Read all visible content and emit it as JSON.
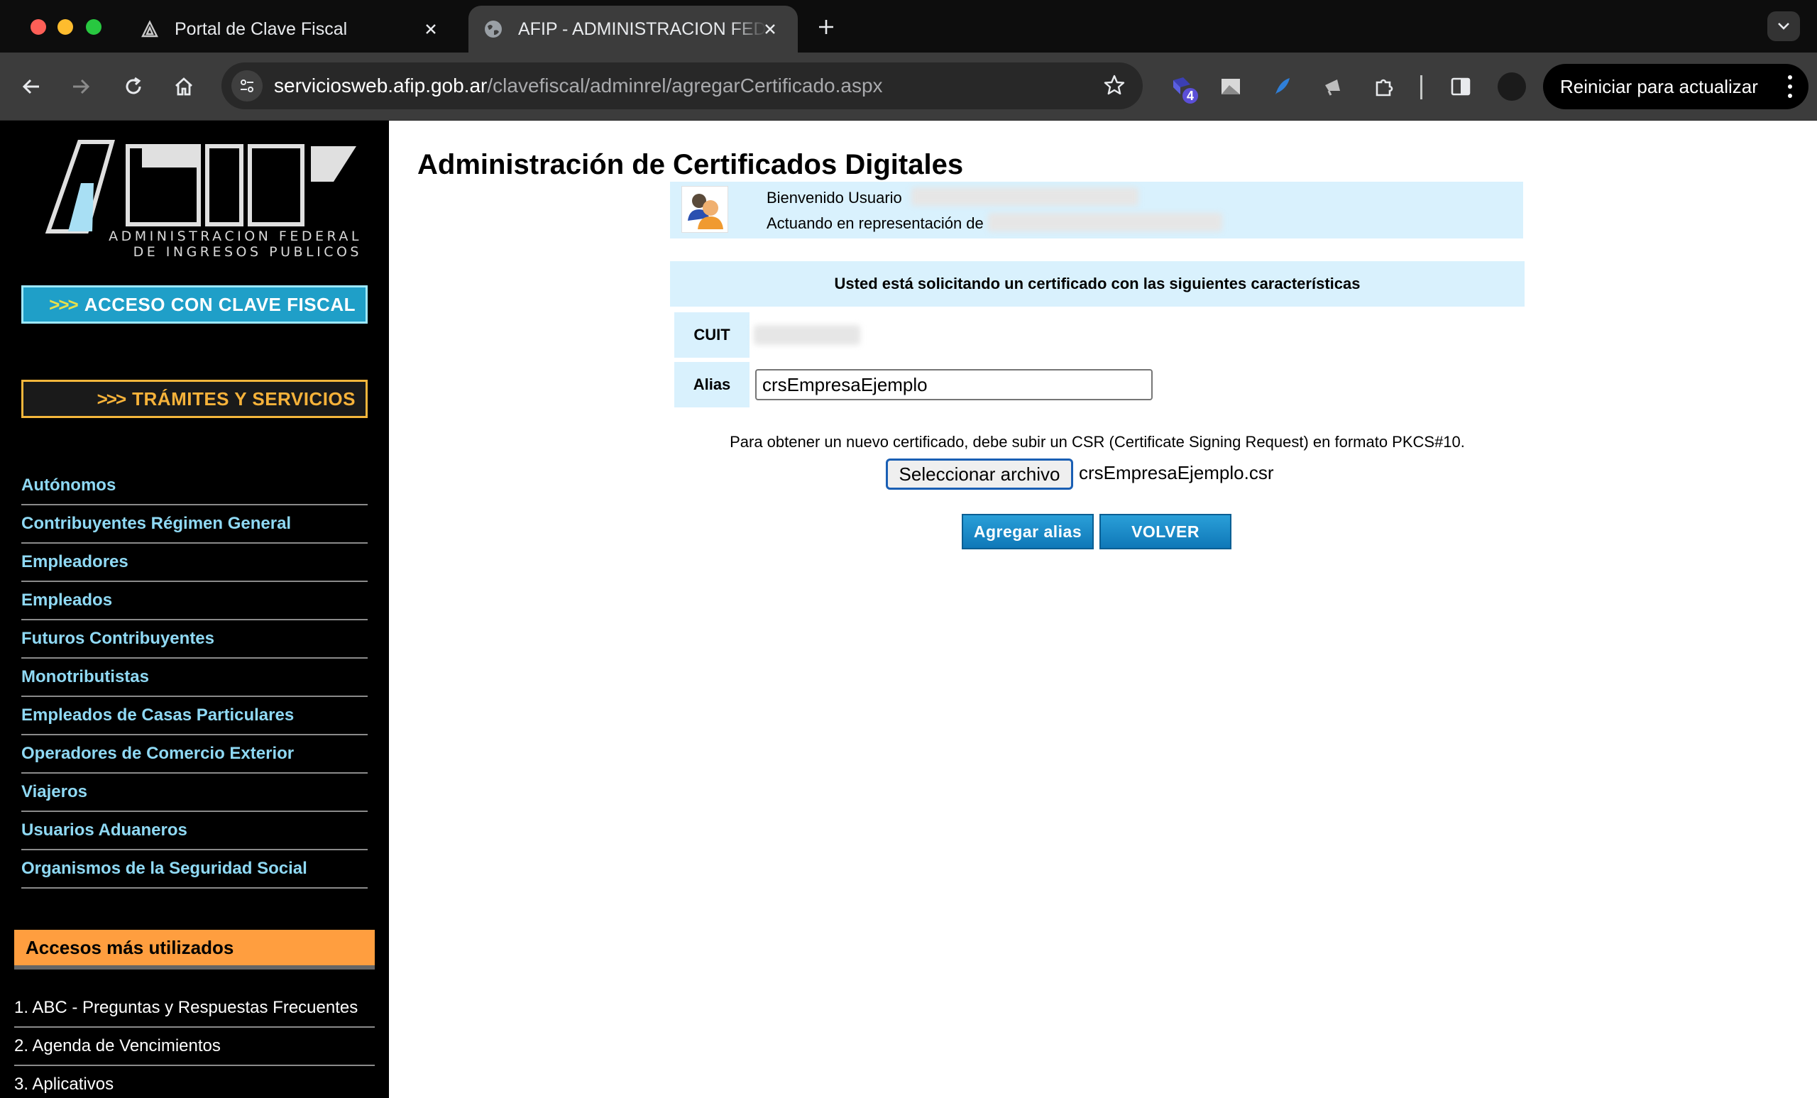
{
  "browser": {
    "tabs": [
      {
        "title": "Portal de Clave Fiscal"
      },
      {
        "title": "AFIP - ADMINISTRACION FEDERAL DE INGRESOS PUBLICOS"
      }
    ],
    "url_host": "serviciosweb.afip.gob.ar",
    "url_path": "/clavefiscal/adminrel/agregarCertificado.aspx",
    "extension_badge": "4",
    "update_button": "Reiniciar para actualizar"
  },
  "sidebar": {
    "logo_line1": "ADMINISTRACION FEDERAL",
    "logo_line2": "DE INGRESOS PUBLICOS",
    "clave_button_chevrons": ">>>",
    "clave_button": "ACCESO CON CLAVE FISCAL",
    "tramites_button_chevrons": ">>>",
    "tramites_button": "TRÁMITES Y SERVICIOS",
    "categories": [
      "Autónomos",
      "Contribuyentes Régimen General",
      "Empleadores",
      "Empleados",
      "Futuros Contribuyentes",
      "Monotributistas",
      "Empleados de Casas Particulares",
      "Operadores de Comercio Exterior",
      "Viajeros",
      "Usuarios Aduaneros",
      "Organismos de la Seguridad Social"
    ],
    "accesos_title": "Accesos más utilizados",
    "accesos": [
      "1. ABC - Preguntas y Respuestas Frecuentes",
      "2. Agenda de Vencimientos",
      "3. Aplicativos"
    ]
  },
  "main": {
    "title": "Administración de Certificados Digitales",
    "welcome_user": "Bienvenido Usuario",
    "acting_for": "Actuando en representación de",
    "request_heading": "Usted está solicitando un certificado con las siguientes características",
    "cuit_label": "CUIT",
    "alias_label": "Alias",
    "alias_value": "crsEmpresaEjemplo",
    "hint": "Para obtener un nuevo certificado, debe subir un CSR (Certificate Signing Request) en formato PKCS#10.",
    "file_button": "Seleccionar archivo",
    "file_name": "crsEmpresaEjemplo.csr",
    "add_alias_button": "Agregar alias",
    "back_button": "VOLVER"
  },
  "colors": {
    "sidebar_bg": "#000000",
    "link_color": "#8fd9f4",
    "panel_bg": "#d9f1fd",
    "accesos_bg": "#ff9e3f",
    "button_blue": "#1a8fcc"
  }
}
